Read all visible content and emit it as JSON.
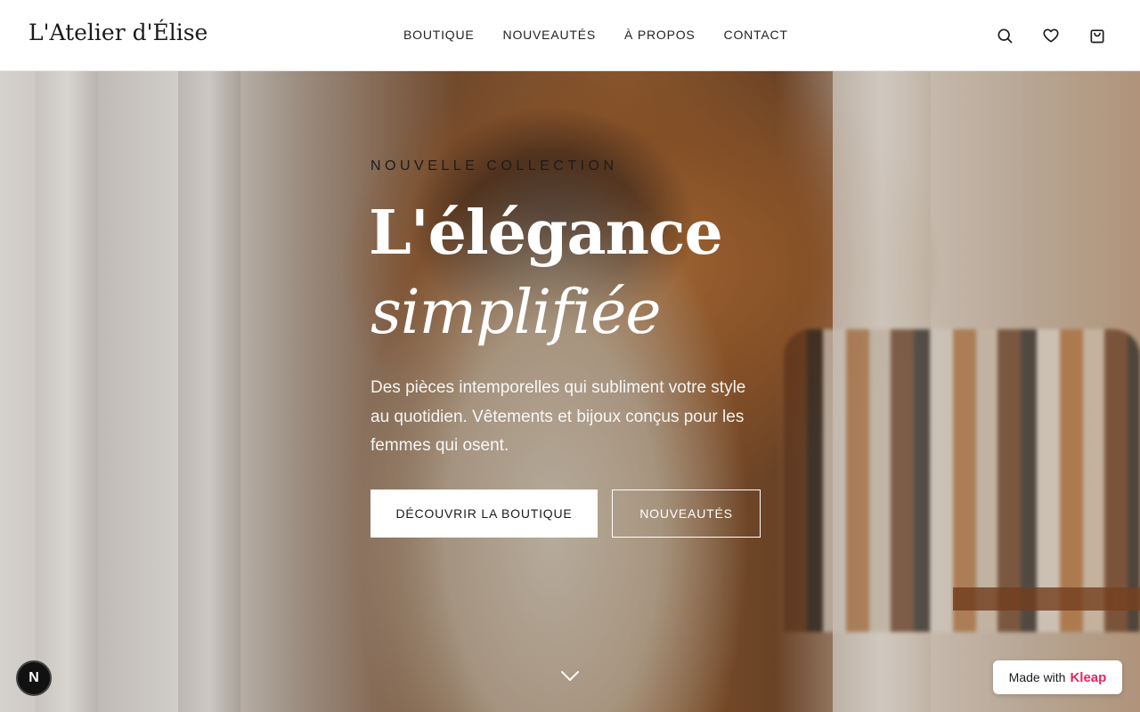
{
  "header": {
    "logo": "L'Atelier d'Élise",
    "nav": [
      {
        "label": "BOUTIQUE"
      },
      {
        "label": "NOUVEAUTÉS"
      },
      {
        "label": "À PROPOS"
      },
      {
        "label": "CONTACT"
      }
    ],
    "icons": [
      "search-icon",
      "heart-icon",
      "shopping-bag-icon"
    ]
  },
  "hero": {
    "eyebrow": "NOUVELLE COLLECTION",
    "title_line1": "L'élégance",
    "title_line2": "simplifiée",
    "description": "Des pièces intemporelles qui subliment votre style au quotidien. Vêtements et bijoux conçus pour les femmes qui osent.",
    "primary_button": "DÉCOUVRIR LA BOUTIQUE",
    "secondary_button": "NOUVEAUTÉS"
  },
  "badges": {
    "n_badge": "N",
    "made_with": "Made with",
    "brand": "Kleap"
  },
  "colors": {
    "header_bg": "#ffffff",
    "text_dark": "#1b1b1b",
    "hero_text": "#ffffff",
    "kleap_brand": "#e8245e"
  }
}
